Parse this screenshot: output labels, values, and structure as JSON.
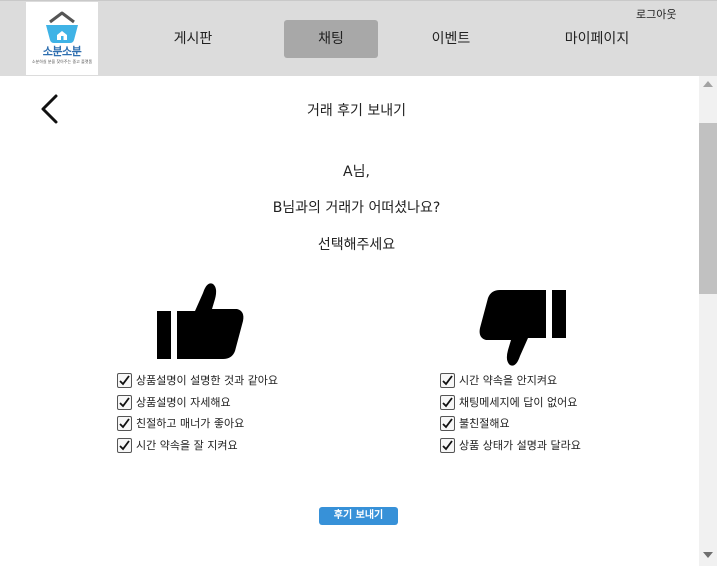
{
  "header": {
    "logo": {
      "title": "소분소분",
      "subtitle": "소분하실 분을 찾아주는 중고 플랫폼"
    },
    "logout_label": "로그아웃",
    "nav": [
      {
        "label": "게시판",
        "active": false
      },
      {
        "label": "채팅",
        "active": true
      },
      {
        "label": "이벤트",
        "active": false
      },
      {
        "label": "마이페이지",
        "active": false
      }
    ],
    "active_color": "#a8a8a8"
  },
  "page": {
    "title": "거래 후기 보내기",
    "greeting": "A님,",
    "question": "B님과의 거래가 어떠셨나요?",
    "instruction": "선택해주세요"
  },
  "review": {
    "good": {
      "icon": "thumbs-up-icon",
      "options": [
        {
          "label": "상품설명이 설명한 것과 같아요",
          "checked": true
        },
        {
          "label": "상품설명이 자세해요",
          "checked": true
        },
        {
          "label": "친절하고 매너가 좋아요",
          "checked": true
        },
        {
          "label": "시간 약속을 잘 지켜요",
          "checked": true
        }
      ]
    },
    "bad": {
      "icon": "thumbs-down-icon",
      "options": [
        {
          "label": "시간 약속을 안지켜요",
          "checked": true
        },
        {
          "label": "채팅메세지에 답이 없어요",
          "checked": true
        },
        {
          "label": "불친절해요",
          "checked": true
        },
        {
          "label": "상품 상태가 설명과 달라요",
          "checked": true
        }
      ]
    }
  },
  "submit": {
    "label": "후기 보내기",
    "color": "#3791d8"
  }
}
